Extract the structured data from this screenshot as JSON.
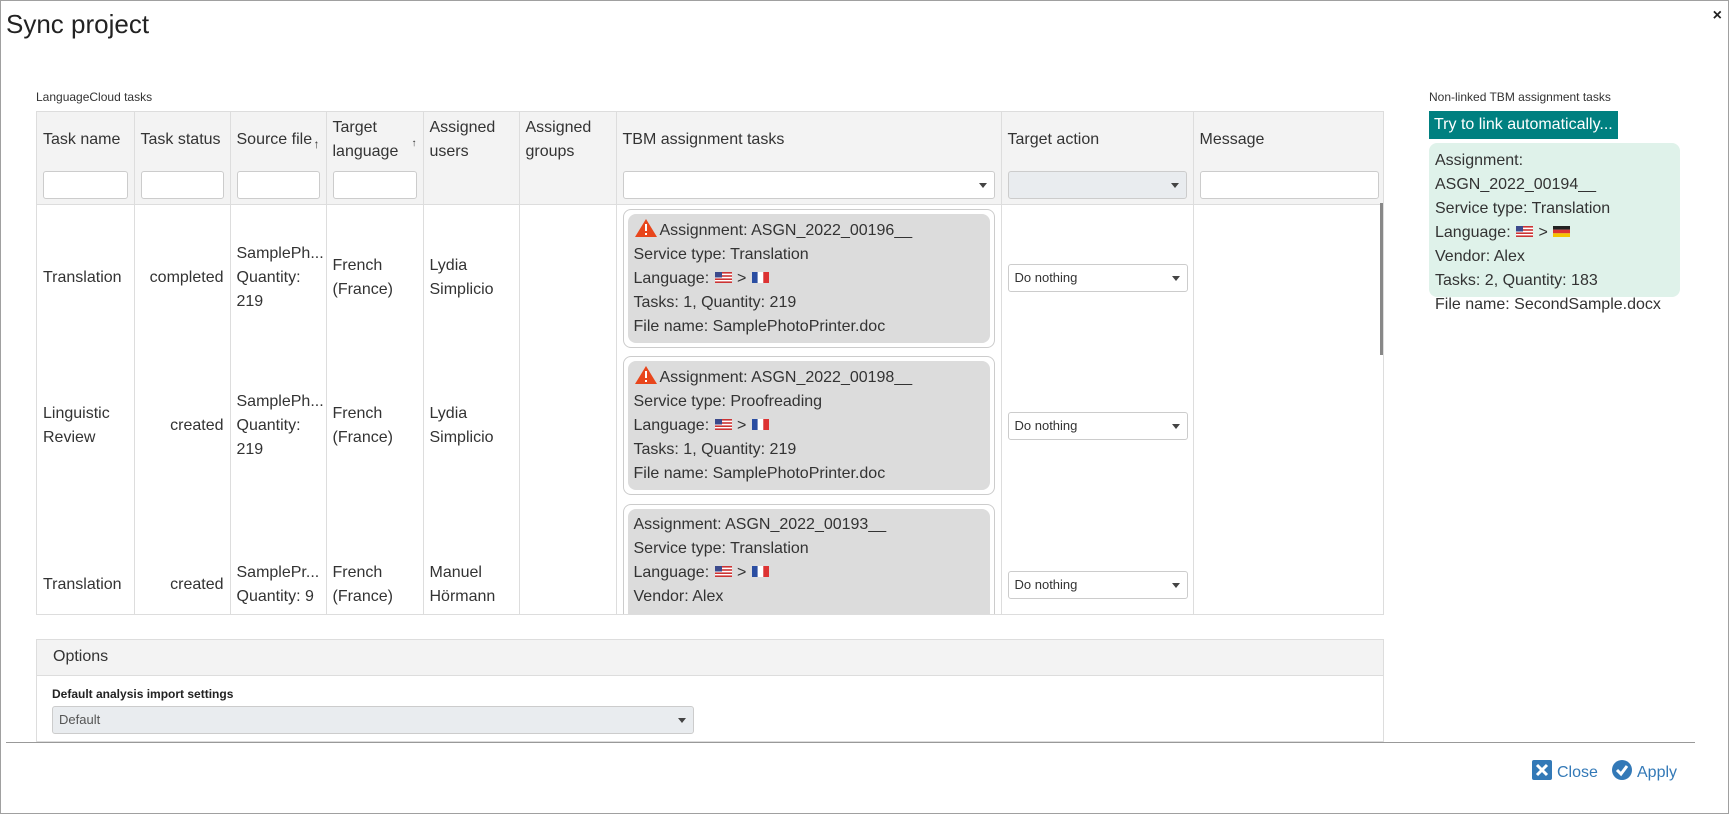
{
  "dialog": {
    "title": "Sync project",
    "close_x": "×"
  },
  "left": {
    "section_label": "LanguageCloud tasks",
    "columns": [
      "Task name",
      "Task status",
      "Source file",
      "Target language",
      "Assigned users",
      "Assigned groups",
      "TBM assignment tasks",
      "Target action",
      "Message"
    ],
    "rows": [
      {
        "task_name": "Translation",
        "task_status": "completed",
        "source_file": "SamplePh...",
        "source_qty": "Quantity: 219",
        "target_language": "French (France)",
        "assigned_users": "Lydia Simplicio",
        "tbm": {
          "warning": true,
          "assignment": "Assignment: ASGN_2022_00196__",
          "service": "Service type: Translation",
          "language_prefix": "Language:",
          "tasks": "Tasks: 1, Quantity: 219",
          "file": "File name: SamplePhotoPrinter.doc"
        },
        "target_action": "Do nothing"
      },
      {
        "task_name": "Linguistic Review",
        "task_status": "created",
        "source_file": "SamplePh...",
        "source_qty": "Quantity: 219",
        "target_language": "French (France)",
        "assigned_users": "Lydia Simplicio",
        "tbm": {
          "warning": true,
          "assignment": "Assignment: ASGN_2022_00198__",
          "service": "Service type: Proofreading",
          "language_prefix": "Language:",
          "tasks": "Tasks: 1, Quantity: 219",
          "file": "File name: SamplePhotoPrinter.doc"
        },
        "target_action": "Do nothing"
      },
      {
        "task_name": "Translation",
        "task_status": "created",
        "source_file": "SamplePr...",
        "source_qty": "Quantity: 9",
        "target_language": "French (France)",
        "assigned_users": "Manuel Hörmann",
        "tbm": {
          "warning": false,
          "assignment": "Assignment: ASGN_2022_00193__",
          "service": "Service type: Translation",
          "language_prefix": "Language:",
          "vendor": "Vendor: Alex"
        },
        "target_action": "Do nothing"
      }
    ]
  },
  "options": {
    "header": "Options",
    "label": "Default analysis import settings",
    "selected": "Default"
  },
  "right": {
    "section_label": "Non-linked TBM assignment tasks",
    "link_button": "Try to link automatically...",
    "card": {
      "assignment": "Assignment: ASGN_2022_00194__",
      "service": "Service type: Translation",
      "language_prefix": "Language:",
      "vendor": "Vendor: Alex",
      "tasks": "Tasks: 2, Quantity: 183",
      "file": "File name: SecondSample.docx"
    }
  },
  "footer": {
    "close_label": "Close",
    "apply_label": "Apply"
  },
  "colors": {
    "accent_teal": "#008080",
    "link_blue": "#3379b7",
    "warning_red": "#e8461c",
    "card_gray": "#dcdcdc",
    "card_green": "#dff2ea"
  }
}
